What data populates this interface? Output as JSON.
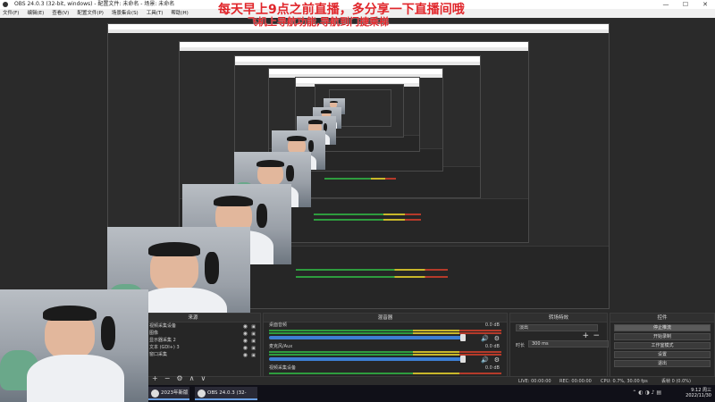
{
  "window": {
    "title": "OBS 24.0.3 (32-bit, windows) - 配置文件: 未命名 - 场景: 未命名",
    "controls": [
      "—",
      "☐",
      "✕"
    ]
  },
  "menu": [
    "文件(F)",
    "编辑(E)",
    "查看(V)",
    "配置文件(P)",
    "场景集合(S)",
    "工具(T)",
    "帮助(H)"
  ],
  "overlay": {
    "line1": "每天早上9点之前直播，多分享一下直播间哦",
    "line2": "飞机上导航功能,导航到门捷乘梯"
  },
  "sources": {
    "title": "来源",
    "items": [
      "视频采集设备",
      "图像",
      "显示器采集 2",
      "文本 (GDI+) 3",
      "窗口采集"
    ]
  },
  "mixer": {
    "title": "混音器",
    "tracks": [
      {
        "name": "桌面音频",
        "db": "0.0 dB"
      },
      {
        "name": "麦克风/Aux",
        "db": "0.0 dB"
      },
      {
        "name": "视频采集设备",
        "db": "0.0 dB"
      }
    ]
  },
  "transitions": {
    "title": "转场特效",
    "selected": "淡出",
    "duration_label": "时长",
    "duration": "300 ms"
  },
  "controls": {
    "title": "控件",
    "buttons": [
      "停止推流",
      "开始录制",
      "工作室模式",
      "设置",
      "退出"
    ]
  },
  "status": {
    "live": "LIVE: 00:00:00",
    "rec": "REC: 00:00:00",
    "cpu": "CPU: 0.7%, 30.00 fps",
    "dropped": "丢帧 0 (0.0%)"
  },
  "taskbar": {
    "items": [
      "2023年新版",
      "OBS 24.0.3 (32-bit..."
    ],
    "time": "9:12 周三",
    "date": "2022/11/30"
  }
}
